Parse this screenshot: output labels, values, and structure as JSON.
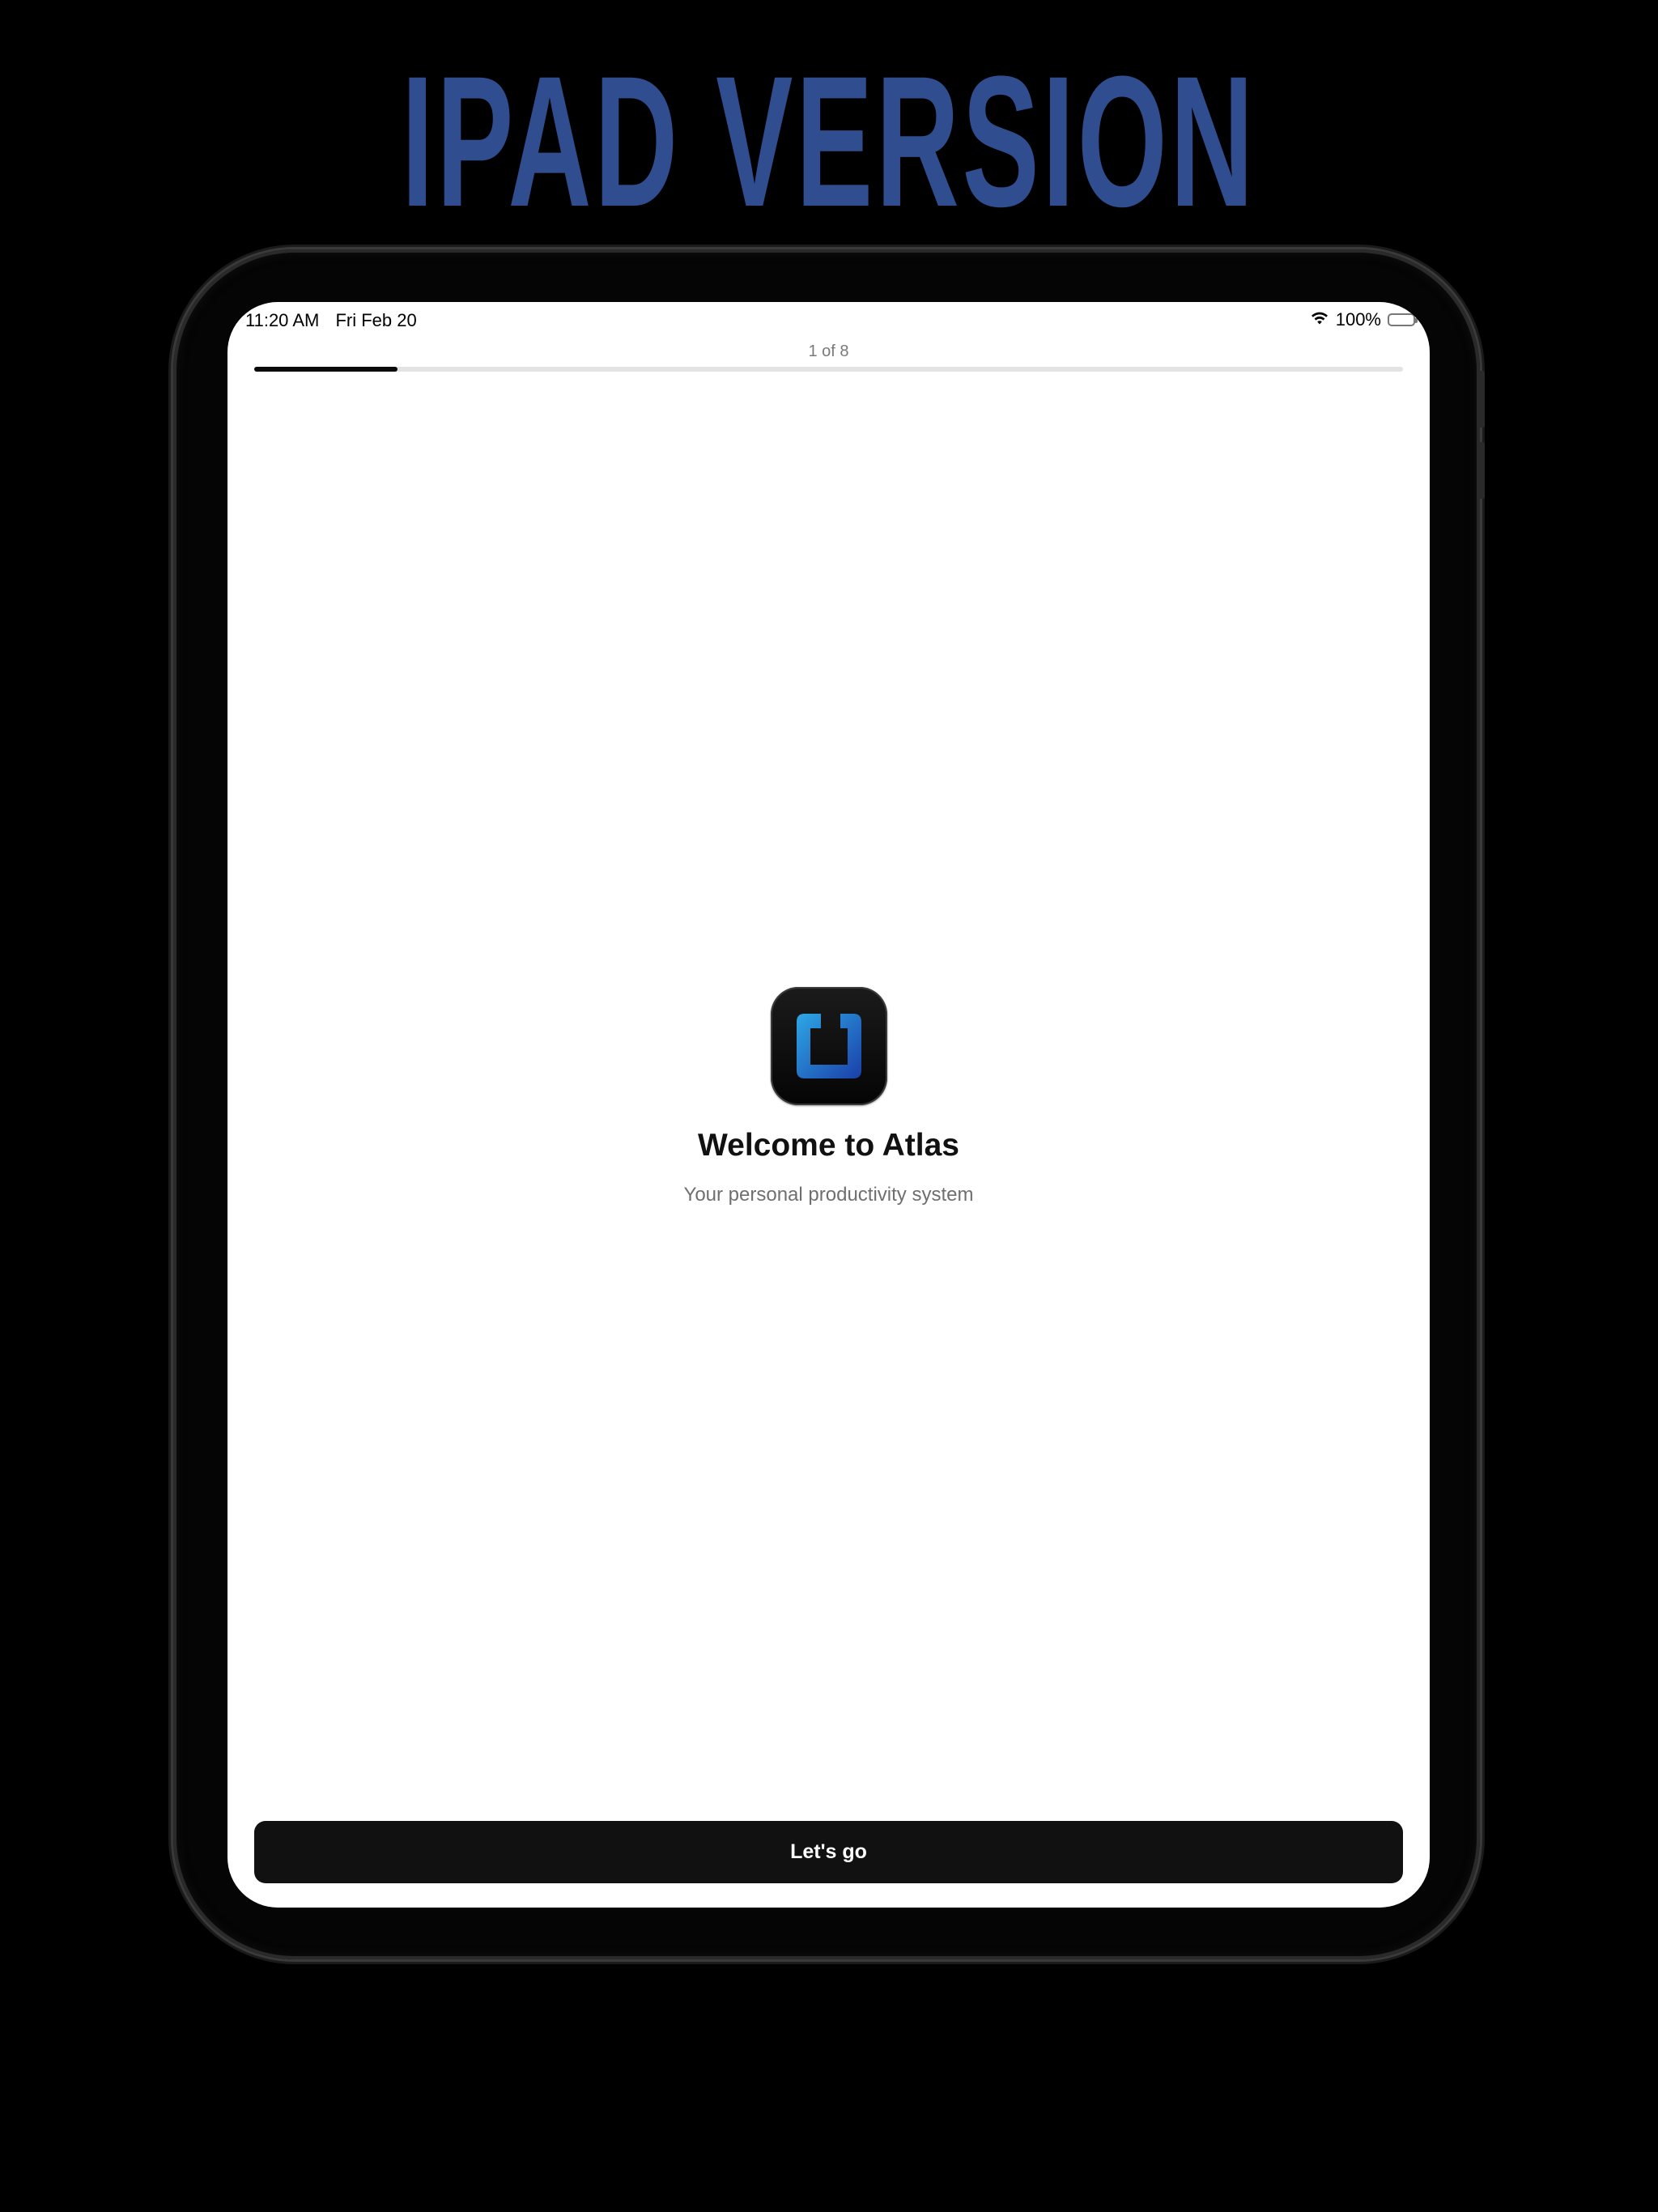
{
  "headline": "IPAD VERSION",
  "colors": {
    "headline": "#2f4d8f",
    "background": "#000000",
    "screen": "#ffffff",
    "button": "#111111",
    "progress_fill": "#0a0a0a",
    "progress_track": "#e3e3e3",
    "icon_accent": "#1e6fd0"
  },
  "status_bar": {
    "time": "11:20 AM",
    "date": "Fri Feb 20",
    "battery": "100%",
    "icons": [
      "wifi-icon",
      "battery-icon"
    ]
  },
  "onboarding": {
    "step_label": "1 of 8",
    "progress_fraction": 0.125,
    "app_icon": "atlas-app-icon",
    "title": "Welcome to Atlas",
    "subtitle": "Your personal productivity system",
    "button_label": "Let's go"
  }
}
